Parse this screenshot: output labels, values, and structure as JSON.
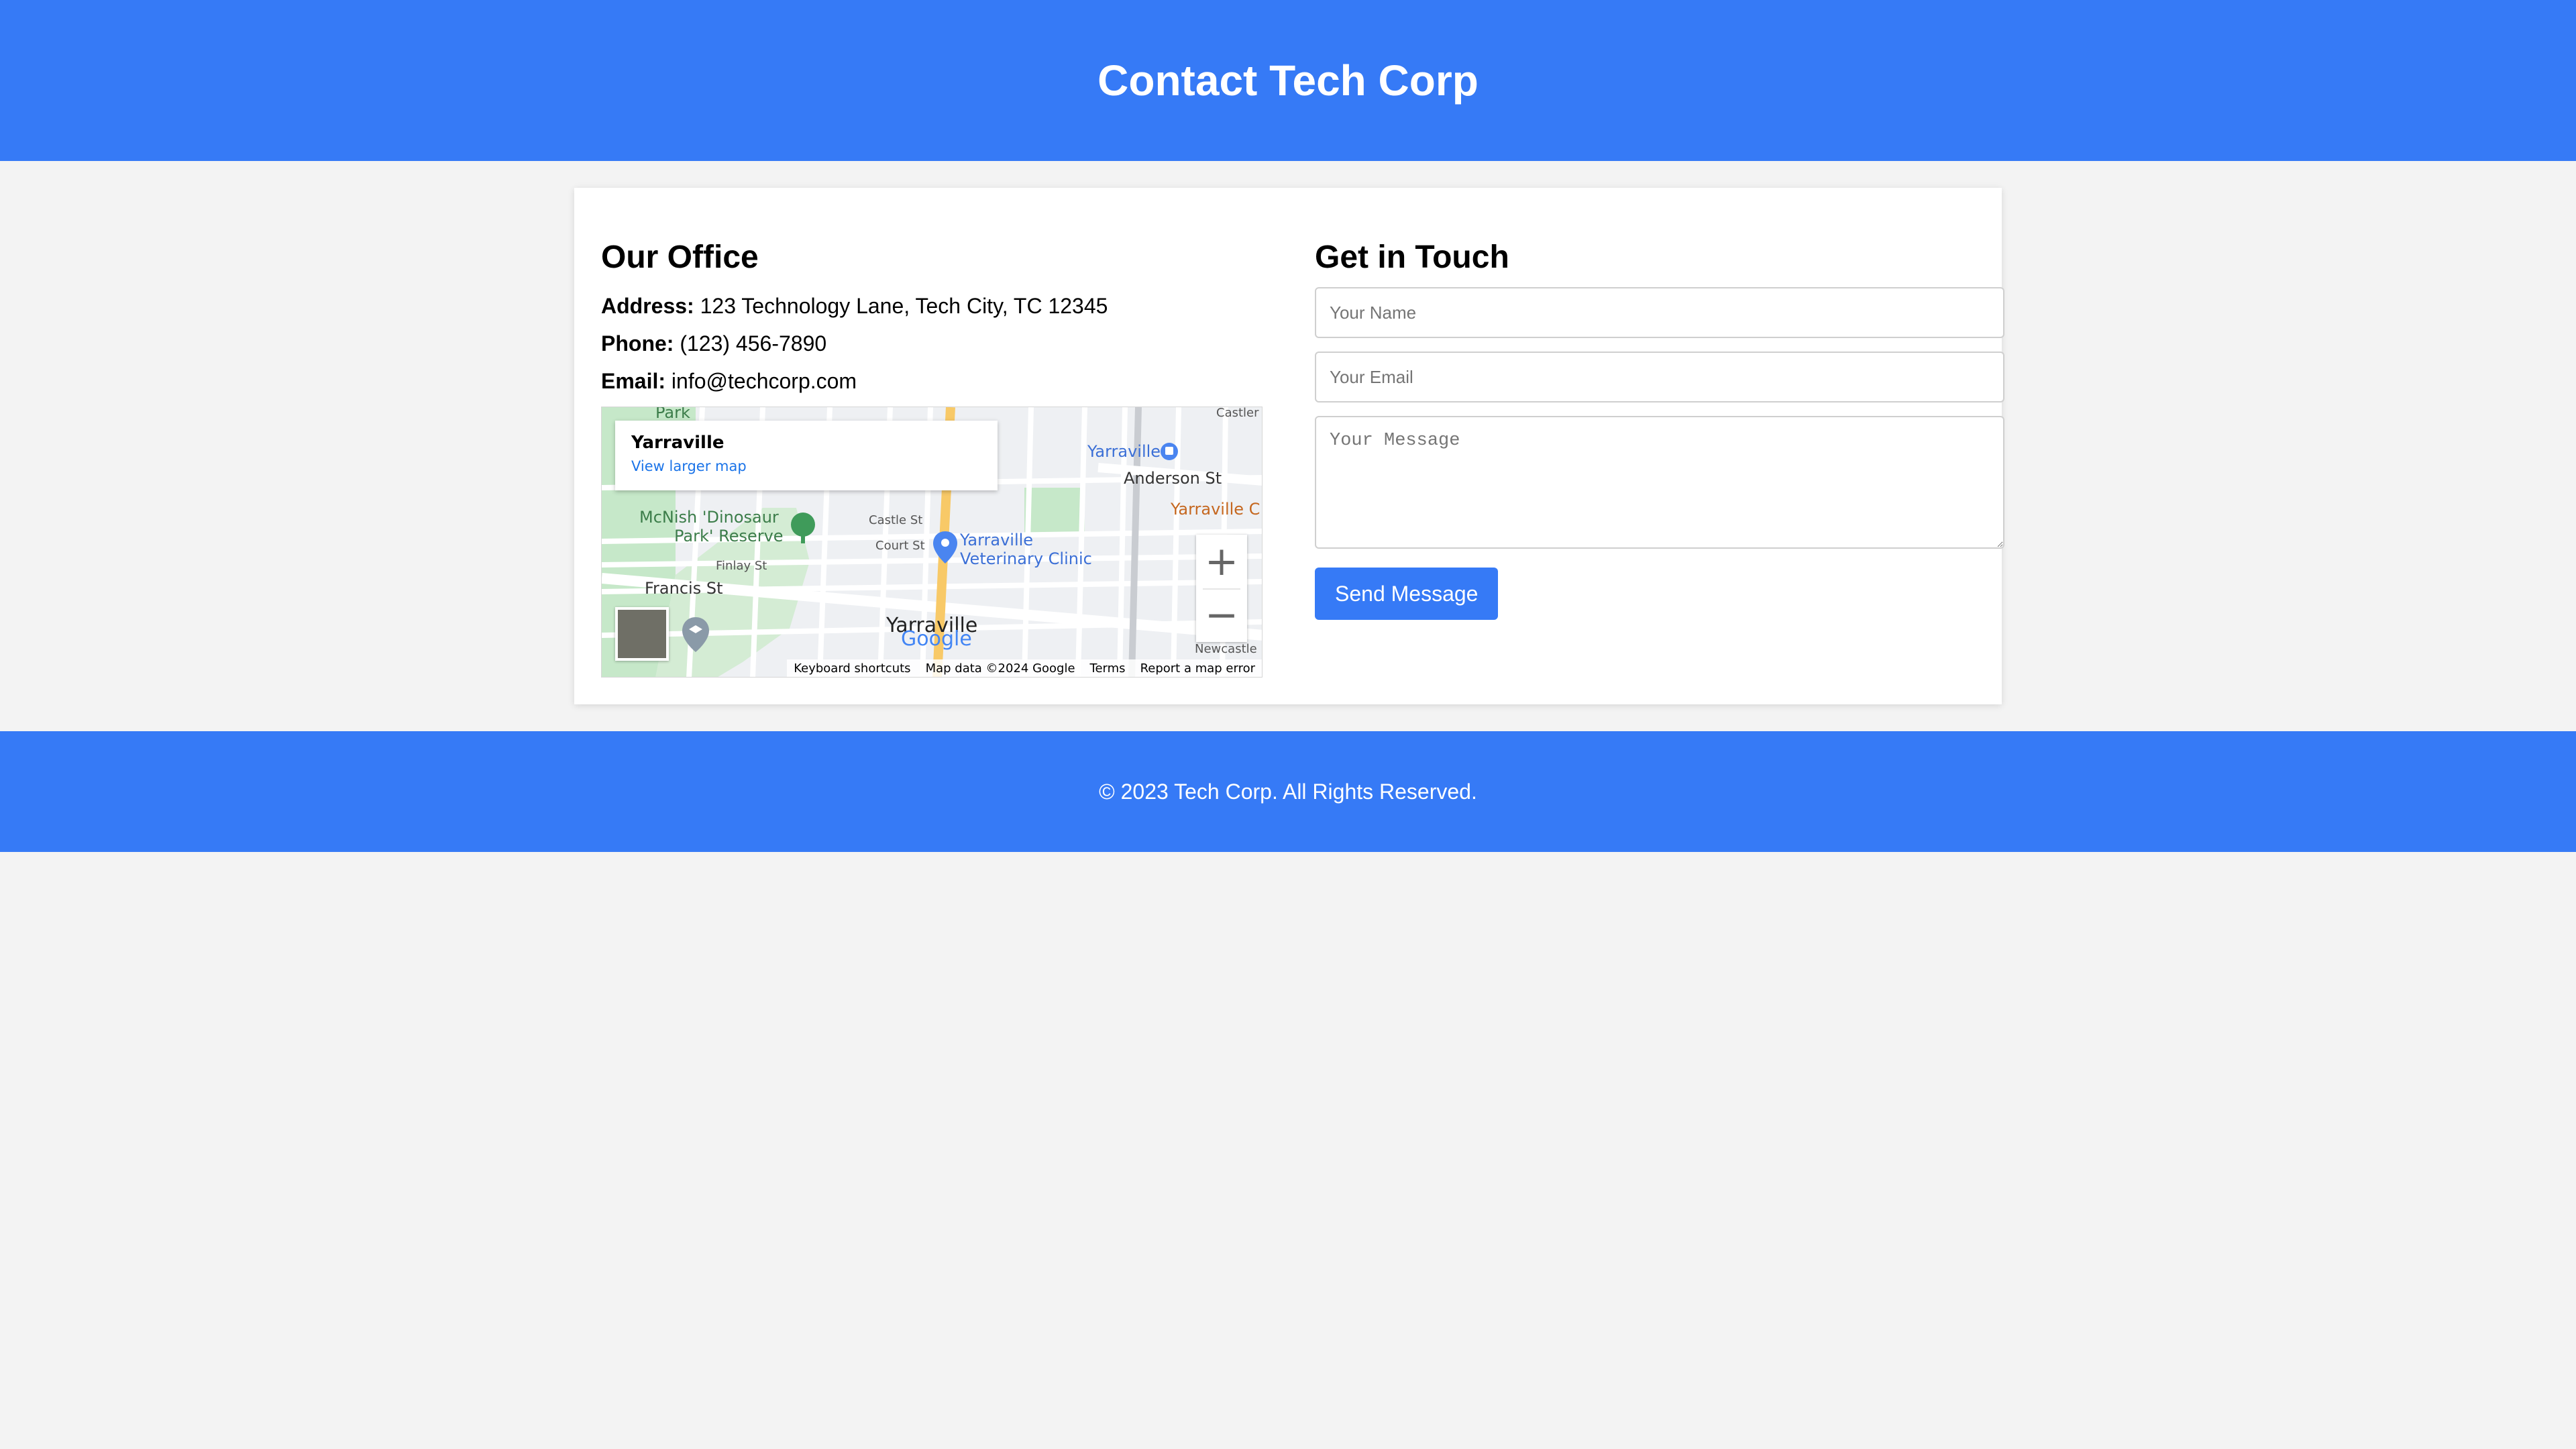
{
  "header": {
    "title": "Contact Tech Corp"
  },
  "office": {
    "heading": "Our Office",
    "address_label": "Address:",
    "address": "123 Technology Lane, Tech City, TC 12345",
    "phone_label": "Phone:",
    "phone": "(123) 456-7890",
    "email_label": "Email:",
    "email": "info@techcorp.com"
  },
  "map": {
    "place_name": "Yarraville",
    "view_larger": "View larger map",
    "labels": {
      "park": "Park",
      "yarraville_station": "Yarraville",
      "anderson_st": "Anderson St",
      "yarraville_c": "Yarraville C",
      "mcnish_line1": "McNish 'Dinosaur",
      "mcnish_line2": "Park' Reserve",
      "castle_st": "Castle St",
      "court_st": "Court St",
      "vet_line1": "Yarraville",
      "vet_line2": "Veterinary Clinic",
      "finlay_st": "Finlay St",
      "francis_st": "Francis St",
      "suburb": "Yarraville",
      "castler": "Castler",
      "newcastle": "Newcastle"
    },
    "google": "Google",
    "zoom_in": "+",
    "zoom_out": "−",
    "attribution": {
      "shortcuts": "Keyboard shortcuts",
      "data": "Map data ©2024 Google",
      "terms": "Terms",
      "report": "Report a map error"
    }
  },
  "contact": {
    "heading": "Get in Touch",
    "name_placeholder": "Your Name",
    "email_placeholder": "Your Email",
    "message_placeholder": "Your Message",
    "send_label": "Send Message"
  },
  "footer": {
    "text": "© 2023 Tech Corp. All Rights Reserved."
  },
  "colors": {
    "brand": "#367af6",
    "link": "#1a73e8",
    "park": "#c6e8c9",
    "road_major": "#f8c967"
  },
  "icons": [
    "zoom-in-icon",
    "zoom-out-icon",
    "map-pin-icon",
    "tree-icon",
    "train-icon",
    "school-icon"
  ]
}
